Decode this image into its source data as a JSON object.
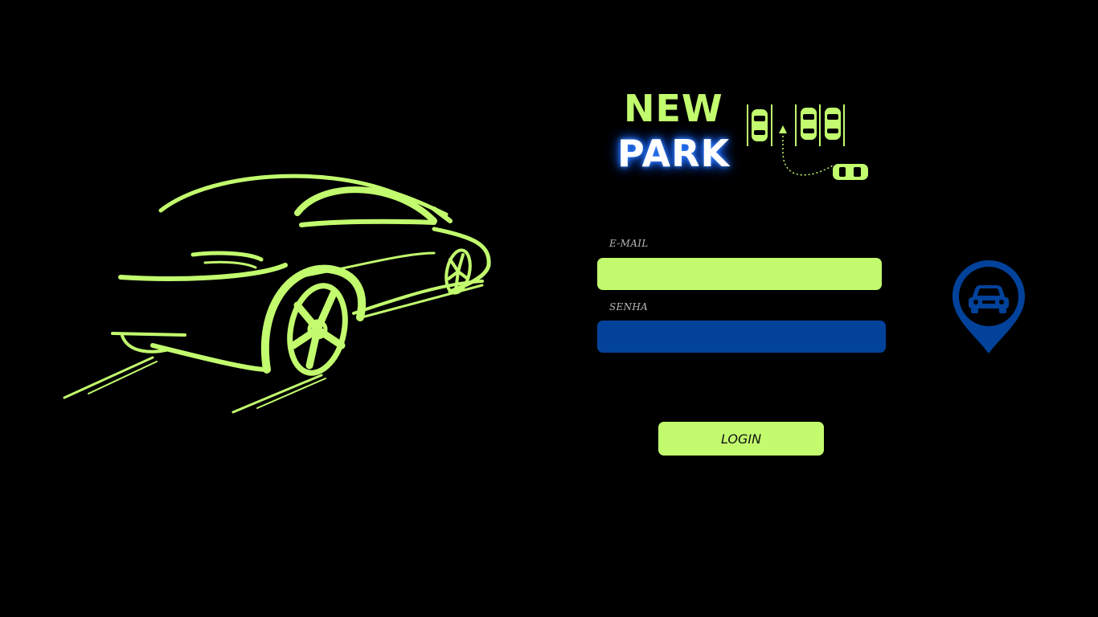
{
  "logo": {
    "line1": "NEW",
    "line2": "PARK",
    "icon": "parking-lot-icon"
  },
  "form": {
    "email_label": "E-MAIL",
    "email_value": "",
    "senha_label": "SENHA",
    "senha_value": "",
    "login_label": "LOGIN"
  },
  "decor": {
    "illustration": "sports-car-outline-icon",
    "pin": "car-location-pin-icon"
  },
  "colors": {
    "background": "#000000",
    "accent_green": "#c2fb6e",
    "accent_blue": "#02429a",
    "label_gray": "#b8b8b8"
  }
}
